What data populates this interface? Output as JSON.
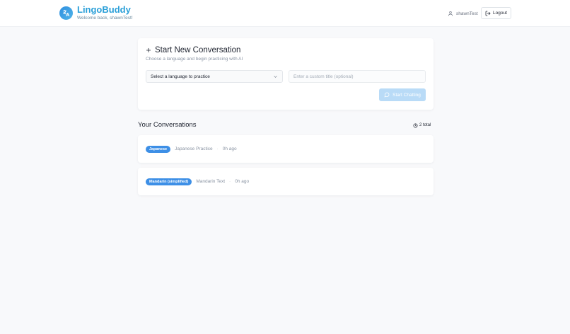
{
  "header": {
    "brand_name": "LingoBuddy",
    "welcome": "Welcome back, shawnTest!",
    "username": "shawnTest",
    "logout_label": "Logout",
    "icons": {
      "logo": "translate-icon",
      "user": "user-icon",
      "logout": "logout-icon"
    }
  },
  "new_conversation": {
    "title": "Start New Conversation",
    "subtitle": "Choose a language and begin practicing with AI",
    "select_label": "Select a language to practice",
    "title_placeholder": "Enter a custom title (optional)",
    "start_label": "Start Chatting",
    "icons": {
      "add": "plus-icon",
      "select": "chevron-down-icon",
      "start": "chat-bubble-icon"
    }
  },
  "conversations": {
    "heading": "Your Conversations",
    "count_label": "2 total",
    "items": [
      {
        "language": "Japanese",
        "title": "Japanese Practice",
        "time": "0h ago"
      },
      {
        "language": "Mandarin (simplified)",
        "title": "Mandarin Text",
        "time": "0h ago"
      }
    ]
  },
  "colors": {
    "brand": "#2a9fd8",
    "badge": "#3d8fe6",
    "start_button_disabled": "#b9dbf7",
    "background": "#f8f9fb"
  }
}
